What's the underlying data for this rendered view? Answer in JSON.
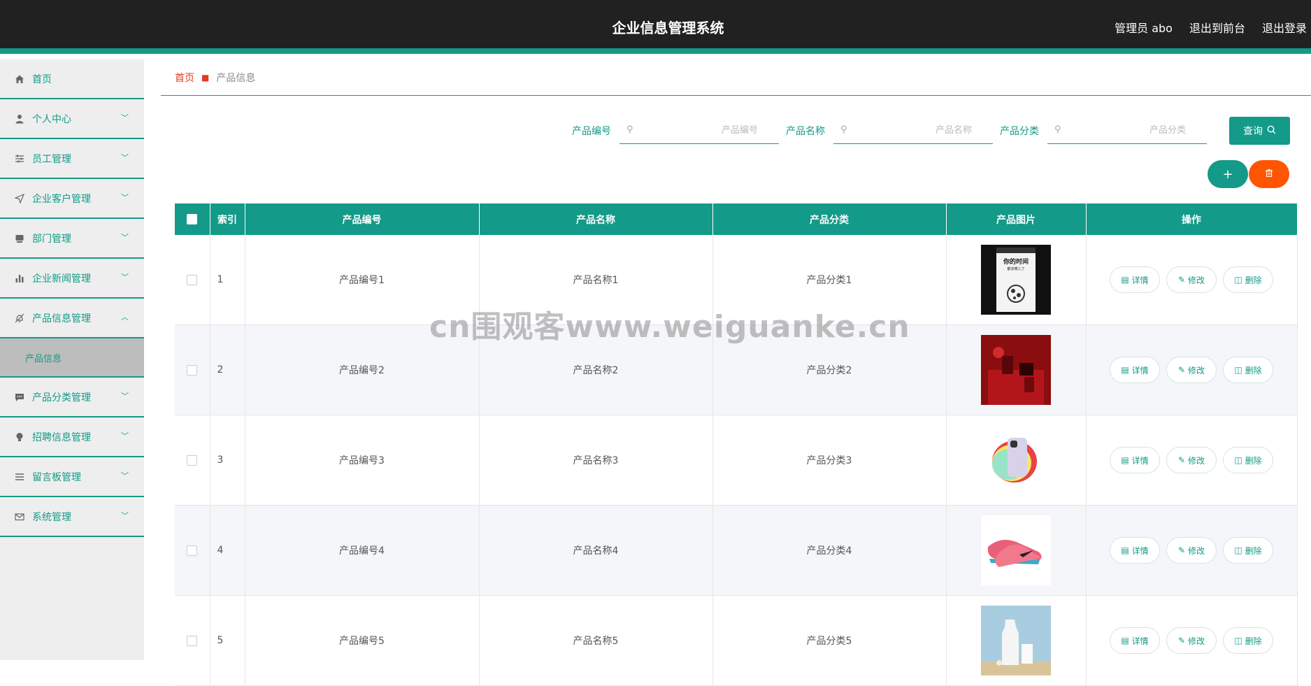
{
  "header": {
    "title": "企业信息管理系统",
    "user": "管理员 abo",
    "front_link": "退出到前台",
    "logout": "退出登录"
  },
  "sidebar": {
    "items": [
      {
        "label": "首页",
        "icon": "home-icon",
        "expandable": false
      },
      {
        "label": "个人中心",
        "icon": "user-icon",
        "expandable": true
      },
      {
        "label": "员工管理",
        "icon": "sliders-icon",
        "expandable": true
      },
      {
        "label": "企业客户管理",
        "icon": "send-icon",
        "expandable": true
      },
      {
        "label": "部门管理",
        "icon": "box-icon",
        "expandable": true
      },
      {
        "label": "企业新闻管理",
        "icon": "bar-chart-icon",
        "expandable": true
      },
      {
        "label": "产品信息管理",
        "icon": "bell-off-icon",
        "expandable": true,
        "expanded": true
      },
      {
        "label": "产品分类管理",
        "icon": "chat-icon",
        "expandable": true
      },
      {
        "label": "招聘信息管理",
        "icon": "bulb-icon",
        "expandable": true
      },
      {
        "label": "留言板管理",
        "icon": "list-icon",
        "expandable": true
      },
      {
        "label": "系统管理",
        "icon": "mail-icon",
        "expandable": true
      }
    ],
    "subitem": "产品信息"
  },
  "breadcrumb": {
    "home": "首页",
    "current": "产品信息"
  },
  "search": {
    "fields": [
      {
        "label": "产品编号",
        "placeholder": "产品编号"
      },
      {
        "label": "产品名称",
        "placeholder": "产品名称"
      },
      {
        "label": "产品分类",
        "placeholder": "产品分类"
      }
    ],
    "query_label": "查询"
  },
  "actions": {
    "add": "+",
    "delete_icon": "trash-icon"
  },
  "table": {
    "columns": [
      "索引",
      "产品编号",
      "产品名称",
      "产品分类",
      "产品图片",
      "操作"
    ],
    "rows": [
      {
        "index": "1",
        "code": "产品编号1",
        "name": "产品名称1",
        "category": "产品分类1",
        "image": "book-cover"
      },
      {
        "index": "2",
        "code": "产品编号2",
        "name": "产品名称2",
        "category": "产品分类2",
        "image": "red-product"
      },
      {
        "index": "3",
        "code": "产品编号3",
        "name": "产品名称3",
        "category": "产品分类3",
        "image": "phones"
      },
      {
        "index": "4",
        "code": "产品编号4",
        "name": "产品名称4",
        "category": "产品分类4",
        "image": "pink-shoes"
      },
      {
        "index": "5",
        "code": "产品编号5",
        "name": "产品名称5",
        "category": "产品分类5",
        "image": "milk"
      }
    ],
    "ops": {
      "detail": "详情",
      "edit": "修改",
      "delete": "删除"
    }
  },
  "watermark": "cn围观客www.weiguanke.cn",
  "colors": {
    "accent": "#139a88",
    "danger": "#ff5500",
    "header_bg": "#212121"
  }
}
